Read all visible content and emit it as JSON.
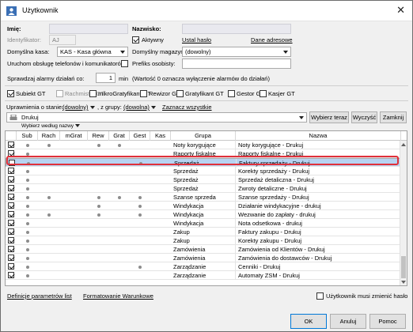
{
  "window": {
    "title": "Użytkownik",
    "close_glyph": "✕"
  },
  "form": {
    "imie_label": "Imię:",
    "nazwisko_label": "Nazwisko:",
    "identyfikator_label": "Identyfikator:",
    "identyfikator_value": "AJ",
    "aktywny_label": "Aktywny",
    "ustal_haslo": "Ustal hasło",
    "dane_adresowe": "Dane adresowe",
    "domyslna_kasa_label": "Domyślna kasa:",
    "domyslna_kasa_value": "KAS - Kasa główna",
    "domyslny_magazyn_label": "Domyślny magazyn:",
    "domyslny_magazyn_value": "(dowolny)",
    "uruchom_label": "Uruchom obsługę telefonów i komunikatorów",
    "prefiks_label": "Prefiks osobisty:",
    "alarm_label": "Sprawdzaj alarmy działań co:",
    "alarm_value": "1",
    "alarm_unit": "min",
    "alarm_note": "(Wartość 0 oznacza wyłączenie alarmów do działań)"
  },
  "roles": [
    {
      "label": "Subiekt GT",
      "checked": true,
      "disabled": false
    },
    {
      "label": "Rachmistrz GT",
      "checked": false,
      "disabled": true
    },
    {
      "label": "mikroGratyfikant GT",
      "checked": false,
      "disabled": false
    },
    {
      "label": "Rewizor GT",
      "checked": false,
      "disabled": false
    },
    {
      "label": "Gratyfikant GT",
      "checked": false,
      "disabled": false
    },
    {
      "label": "Gestor GT",
      "checked": false,
      "disabled": false
    },
    {
      "label": "Kasjer GT",
      "checked": false,
      "disabled": false
    }
  ],
  "perms": {
    "uprawnienia_label": "Uprawnienia o stanie:",
    "stan_value": "(dowolny)",
    "grupy_label": ", z grupy:",
    "grupy_value": "(dowolna)",
    "zaznacz": "Zaznacz wszystkie",
    "filter_value": "Drukuj",
    "wybierz_teraz": "Wybierz teraz",
    "wyczysc": "Wyczyść",
    "zamknij": "Zamknij",
    "wybierz_wedlug": "Wybierz według nazwy"
  },
  "columns": [
    "Sub",
    "Rach",
    "mGrat",
    "Rew",
    "Grat",
    "Gest",
    "Kas",
    "Grupa",
    "Nazwa"
  ],
  "rows": [
    {
      "checked": true,
      "dots": [
        1,
        1,
        0,
        1,
        1,
        0,
        0
      ],
      "grupa": "Noty korygujące",
      "nazwa": "Noty korygujące - Drukuj"
    },
    {
      "checked": true,
      "dots": [
        1,
        0,
        0,
        0,
        0,
        0,
        0
      ],
      "grupa": "Raporty fiskalne",
      "nazwa": "Raporty fiskalne - Drukuj"
    },
    {
      "checked": false,
      "dots": [
        1,
        0,
        0,
        0,
        0,
        1,
        0
      ],
      "grupa": "Sprzedaż",
      "nazwa": "Faktury sprzedaży - Drukuj",
      "selected": true
    },
    {
      "checked": true,
      "dots": [
        1,
        0,
        0,
        0,
        0,
        0,
        0
      ],
      "grupa": "Sprzedaż",
      "nazwa": "Korekty sprzedaży - Drukuj"
    },
    {
      "checked": true,
      "dots": [
        1,
        0,
        0,
        0,
        0,
        0,
        0
      ],
      "grupa": "Sprzedaż",
      "nazwa": "Sprzedaż detaliczna - Drukuj"
    },
    {
      "checked": true,
      "dots": [
        1,
        0,
        0,
        0,
        0,
        0,
        0
      ],
      "grupa": "Sprzedaż",
      "nazwa": "Zwroty detaliczne - Drukuj"
    },
    {
      "checked": true,
      "dots": [
        1,
        1,
        0,
        1,
        1,
        1,
        0
      ],
      "grupa": "Szanse sprzeda",
      "nazwa": "Szanse sprzedaży - Drukuj"
    },
    {
      "checked": true,
      "dots": [
        1,
        0,
        0,
        1,
        0,
        1,
        0
      ],
      "grupa": "Windykacja",
      "nazwa": "Działanie windykacyjne - drukuj"
    },
    {
      "checked": true,
      "dots": [
        1,
        1,
        0,
        1,
        0,
        1,
        0
      ],
      "grupa": "Windykacja",
      "nazwa": "Wezwanie do zapłaty - drukuj"
    },
    {
      "checked": true,
      "dots": [
        1,
        0,
        0,
        0,
        0,
        0,
        0
      ],
      "grupa": "Windykacja",
      "nazwa": "Nota odsetkowa - drukuj"
    },
    {
      "checked": true,
      "dots": [
        1,
        0,
        0,
        0,
        0,
        0,
        0
      ],
      "grupa": "Zakup",
      "nazwa": "Faktury zakupu - Drukuj"
    },
    {
      "checked": true,
      "dots": [
        1,
        0,
        0,
        0,
        0,
        0,
        0
      ],
      "grupa": "Zakup",
      "nazwa": "Korekty zakupu - Drukuj"
    },
    {
      "checked": true,
      "dots": [
        1,
        0,
        0,
        0,
        0,
        0,
        0
      ],
      "grupa": "Zamówienia",
      "nazwa": "Zamówienia od Klientów - Drukuj"
    },
    {
      "checked": true,
      "dots": [
        1,
        0,
        0,
        0,
        0,
        0,
        0
      ],
      "grupa": "Zamówienia",
      "nazwa": "Zamówienia do dostawców - Drukuj"
    },
    {
      "checked": true,
      "dots": [
        1,
        0,
        0,
        0,
        0,
        1,
        0
      ],
      "grupa": "Zarządzanie",
      "nazwa": "Cenniki - Drukuj"
    },
    {
      "checked": true,
      "dots": [
        1,
        0,
        0,
        0,
        0,
        0,
        0
      ],
      "grupa": "Zarządzanie",
      "nazwa": "Automaty ZSM - Drukuj"
    }
  ],
  "footer": {
    "definicje": "Definicje parametrów list",
    "formatowanie": "Formatowanie Warunkowe",
    "musi_zmienic": "Użytkownik musi zmienić hasło",
    "ok": "OK",
    "anuluj": "Anuluj",
    "pomoc": "Pomoc"
  }
}
